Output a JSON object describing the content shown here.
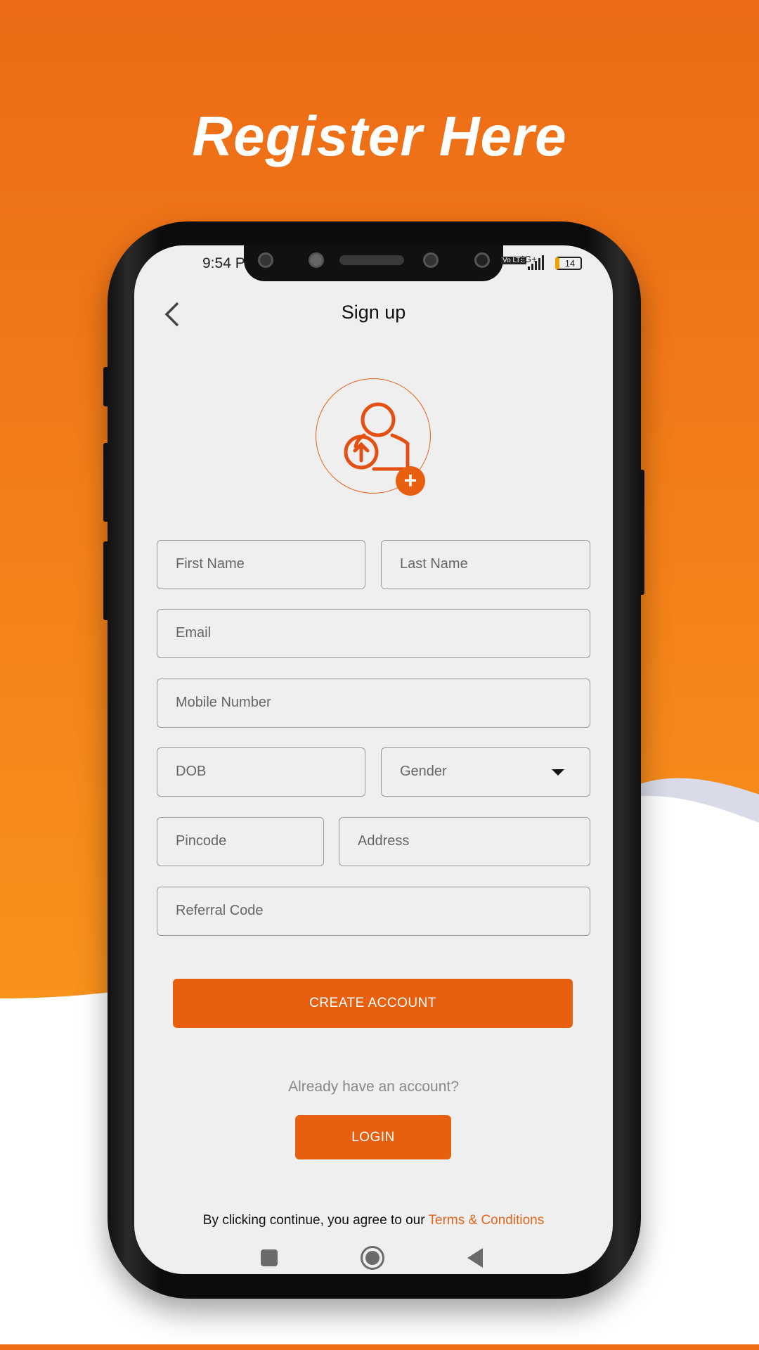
{
  "headline": "Register Here",
  "colors": {
    "brand_orange": "#e8600f",
    "bg_orange_top": "#ec6f17",
    "bg_orange_bottom": "#f7901c",
    "accent_link": "#e2661c"
  },
  "status_bar": {
    "time": "9:54 P",
    "network": "4G+",
    "volte": "Vo LTE",
    "battery": "14"
  },
  "header": {
    "back_icon": "chevron-left-icon",
    "title": "Sign up"
  },
  "avatar": {
    "icon": "user-upload-icon",
    "badge_icon": "plus-icon",
    "badge": "+"
  },
  "form": {
    "first_name": {
      "placeholder": "First Name"
    },
    "last_name": {
      "placeholder": "Last Name"
    },
    "email": {
      "placeholder": "Email"
    },
    "mobile": {
      "placeholder": "Mobile Number"
    },
    "dob": {
      "placeholder": "DOB"
    },
    "gender": {
      "selected": "Gender"
    },
    "pincode": {
      "placeholder": "Pincode"
    },
    "address": {
      "placeholder": "Address"
    },
    "referral": {
      "placeholder": "Referral Code"
    }
  },
  "create_account_label": "CREATE ACCOUNT",
  "already_text": "Already have an account?",
  "login_label": "LOGIN",
  "terms": {
    "prefix": "By clicking continue, you agree to our ",
    "link": "Terms & Conditions"
  },
  "nav_bar": {
    "recents": "square-icon",
    "home": "circle-icon",
    "back": "triangle-back-icon"
  }
}
